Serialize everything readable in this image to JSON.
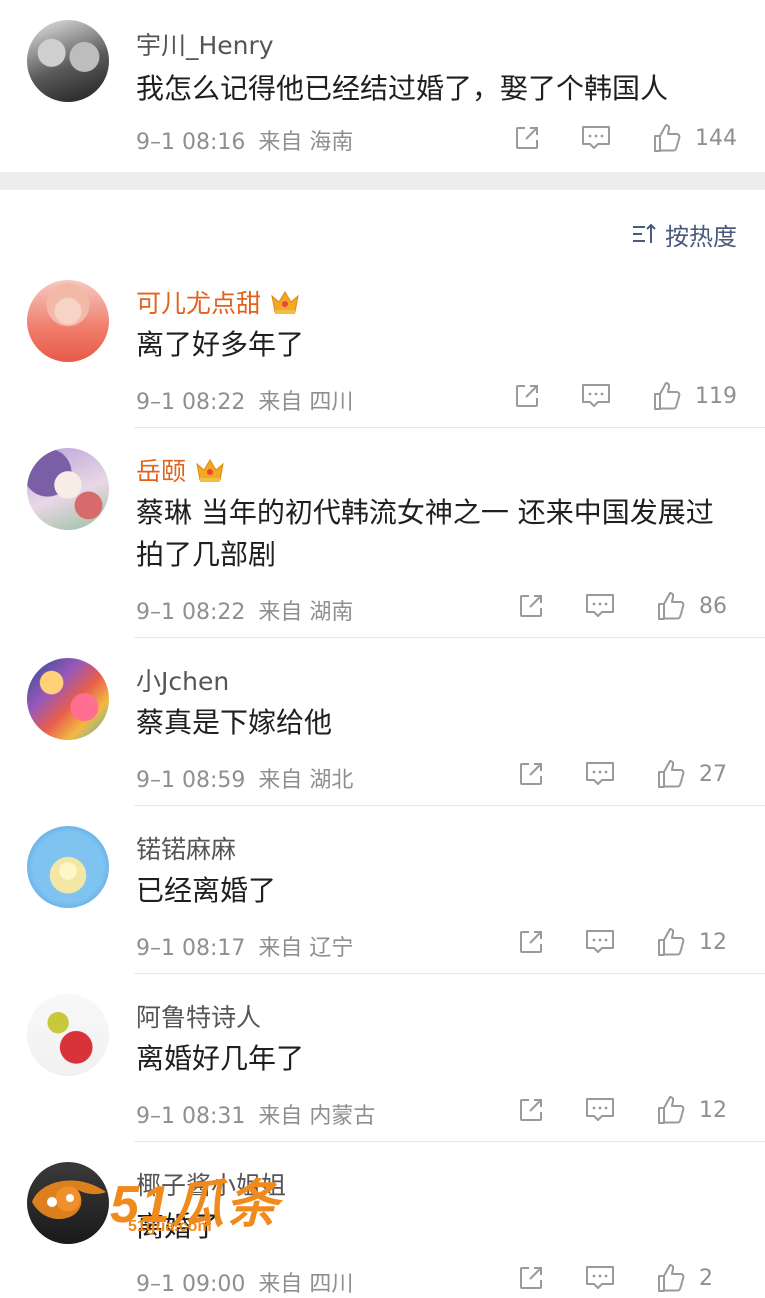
{
  "top_comment": {
    "username": "宇川_Henry",
    "text": "我怎么记得他已经结过婚了，娶了个韩国人",
    "time": "9–1 08:16",
    "location": "来自 海南",
    "likes": "144"
  },
  "sort": {
    "label": "按热度",
    "icon": "sort-icon"
  },
  "comments": [
    {
      "username": "可儿尤点甜",
      "vip": true,
      "text": "离了好多年了",
      "time": "9–1 08:22",
      "location": "来自 四川",
      "likes": "119"
    },
    {
      "username": "岳颐",
      "vip": true,
      "text": "蔡琳 当年的初代韩流女神之一 还来中国发展过拍了几部剧",
      "time": "9–1 08:22",
      "location": "来自 湖南",
      "likes": "86"
    },
    {
      "username": "小Jchen",
      "vip": false,
      "text": "蔡真是下嫁给他",
      "time": "9–1 08:59",
      "location": "来自 湖北",
      "likes": "27"
    },
    {
      "username": "锘锘麻麻",
      "vip": false,
      "text": "已经离婚了",
      "time": "9–1 08:17",
      "location": "来自 辽宁",
      "likes": "12"
    },
    {
      "username": "阿鲁特诗人",
      "vip": false,
      "text": "离婚好几年了",
      "time": "9–1 08:31",
      "location": "来自 内蒙古",
      "likes": "12"
    },
    {
      "username": "椰子酱小姐姐",
      "vip": false,
      "text": "离婚了",
      "time": "9–1 09:00",
      "location": "来自 四川",
      "likes": "2"
    }
  ],
  "watermark": {
    "main": "51瓜条",
    "sub": "51gua.com"
  },
  "colors": {
    "vip_name": "#e0621b",
    "meta": "#8f8f8f",
    "divider": "#ededed",
    "watermark": "#f08a1c"
  }
}
